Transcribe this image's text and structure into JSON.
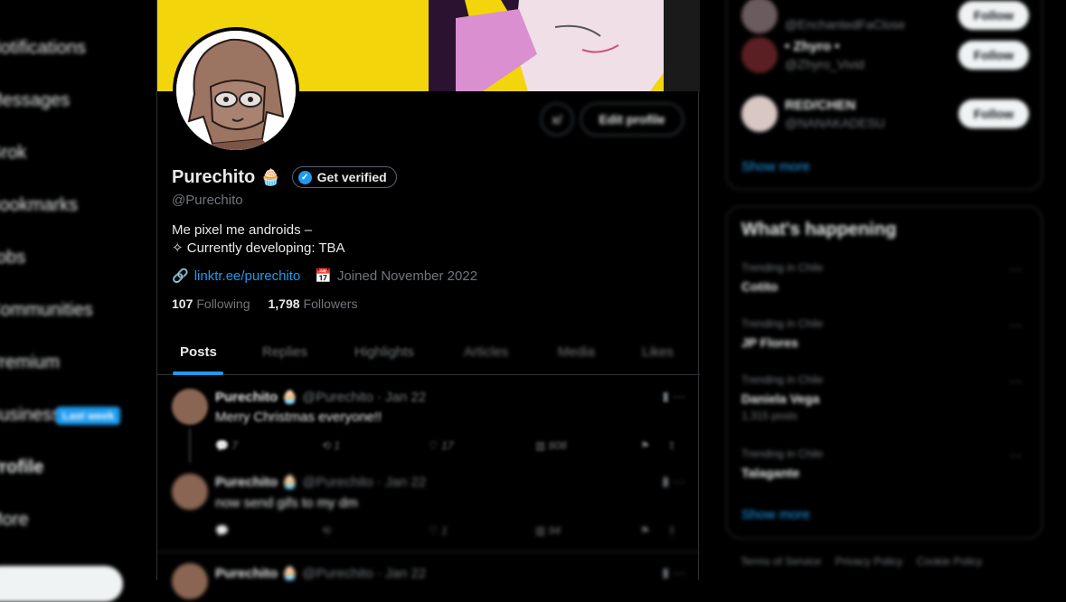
{
  "nav": {
    "items": [
      {
        "label": "Notifications"
      },
      {
        "label": "Messages"
      },
      {
        "label": "Grok"
      },
      {
        "label": "Bookmarks"
      },
      {
        "label": "Jobs"
      },
      {
        "label": "Communities"
      },
      {
        "label": "Premium"
      },
      {
        "label": "Business"
      },
      {
        "label": "Profile"
      },
      {
        "label": "More"
      }
    ],
    "badge": "Last week"
  },
  "profile": {
    "name": "Purechito",
    "emoji": "🧁",
    "verify_label": "Get verified",
    "handle": "@Purechito",
    "bio_line1": "Me pixel me androids –",
    "bio_line2": "✧ Currently developing: TBA",
    "link": "linktr.ee/purechito",
    "joined": "Joined November 2022",
    "following_count": "107",
    "following_label": "Following",
    "followers_count": "1,798",
    "followers_label": "Followers",
    "edit_label": "Edit profile",
    "grok_label": "x/"
  },
  "tabs": [
    {
      "label": "Posts"
    },
    {
      "label": "Replies"
    },
    {
      "label": "Highlights"
    },
    {
      "label": "Articles"
    },
    {
      "label": "Media"
    },
    {
      "label": "Likes"
    }
  ],
  "posts": [
    {
      "name": "Purechito",
      "emoji": "🧁",
      "meta": "@Purechito · Jan 22",
      "text": "Merry Christmas everyone!!",
      "replies": "7",
      "reposts": "1",
      "likes": "17",
      "views": "808"
    },
    {
      "name": "Purechito",
      "emoji": "🧁",
      "meta": "@Purechito · Jan 22",
      "text": "now send gifs to my dm",
      "replies": "",
      "reposts": "",
      "likes": "1",
      "views": "94"
    },
    {
      "name": "Purechito",
      "emoji": "🧁",
      "meta": "@Purechito · Jan 22",
      "text": "",
      "replies": "",
      "reposts": "",
      "likes": "",
      "views": ""
    }
  ],
  "who_to_follow": {
    "items": [
      {
        "name": "EnchantedFaClose",
        "handle": "@EnchantedFaClose",
        "follow": "Follow"
      },
      {
        "name": "• Zhyro •",
        "handle": "@Zhyro_Vivid",
        "follow": "Follow"
      },
      {
        "name": "RED/CHEN",
        "handle": "@NANAKADESU",
        "follow": "Follow"
      }
    ],
    "show_more": "Show more"
  },
  "whats_happening": {
    "title": "What's happening",
    "trends": [
      {
        "category": "Trending in Chile",
        "name": "Cotito",
        "posts": ""
      },
      {
        "category": "Trending in Chile",
        "name": "JP Flores",
        "posts": ""
      },
      {
        "category": "Trending in Chile",
        "name": "Daniela Vega",
        "posts": "1,315 posts"
      },
      {
        "category": "Trending in Chile",
        "name": "Talagante",
        "posts": ""
      }
    ],
    "show_more": "Show more"
  },
  "footer": {
    "links": [
      "Terms of Service",
      "Privacy Policy",
      "Cookie Policy"
    ]
  },
  "colors": {
    "accent": "#1d9bf0",
    "banner": "#f2d50b",
    "background": "#000000"
  }
}
